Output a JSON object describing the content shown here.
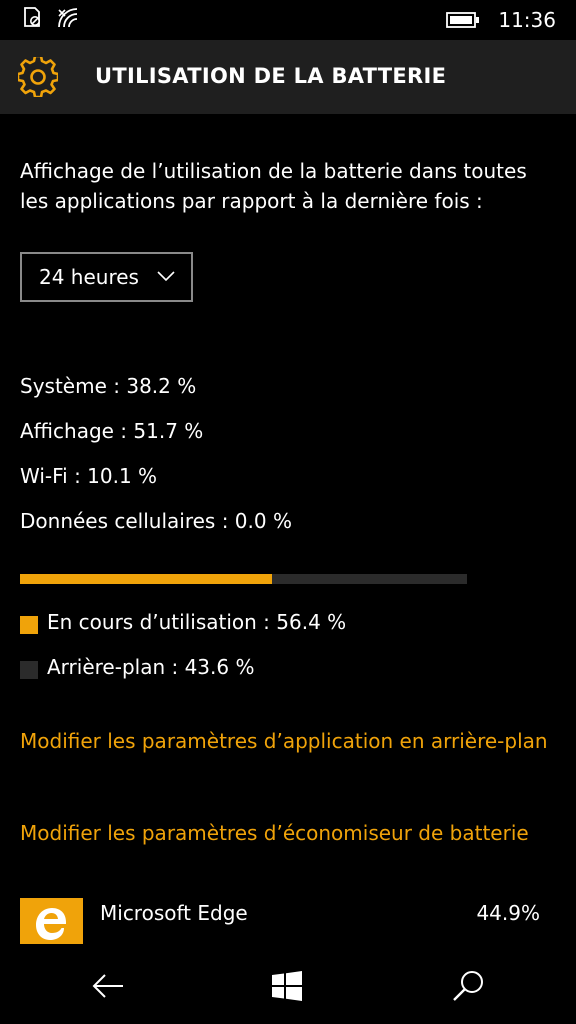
{
  "status_bar": {
    "time": "11:36"
  },
  "header": {
    "title": "UTILISATION DE LA BATTERIE",
    "icon": "gear-icon"
  },
  "intro_text": "Affichage de l’utilisation de la batterie dans toutes les applications par rapport à la dernière fois :",
  "period_select": {
    "selected": "24 heures"
  },
  "usage_breakdown": [
    {
      "label": "Système : 38.2 %"
    },
    {
      "label": "Affichage : 51.7 %"
    },
    {
      "label": "Wi-Fi : 10.1 %"
    },
    {
      "label": "Données cellulaires : 0.0 %"
    }
  ],
  "usage_bar": {
    "in_use_fraction": 0.564
  },
  "legend": {
    "in_use": "En cours d’utilisation : 56.4 %",
    "background": "Arrière-plan : 43.6 %"
  },
  "links": {
    "background_apps": "Modifier les paramètres d’application en arrière-plan",
    "battery_saver": "Modifier les paramètres d’économiseur de batterie"
  },
  "apps": [
    {
      "name": "Microsoft Edge",
      "percent": "44.9%",
      "icon": "edge-icon"
    }
  ],
  "colors": {
    "accent": "#f0a30a",
    "background": "#000000",
    "header": "#1f1f1f",
    "bar_track": "#2b2b2b",
    "background_swatch": "#2b2b2b"
  }
}
